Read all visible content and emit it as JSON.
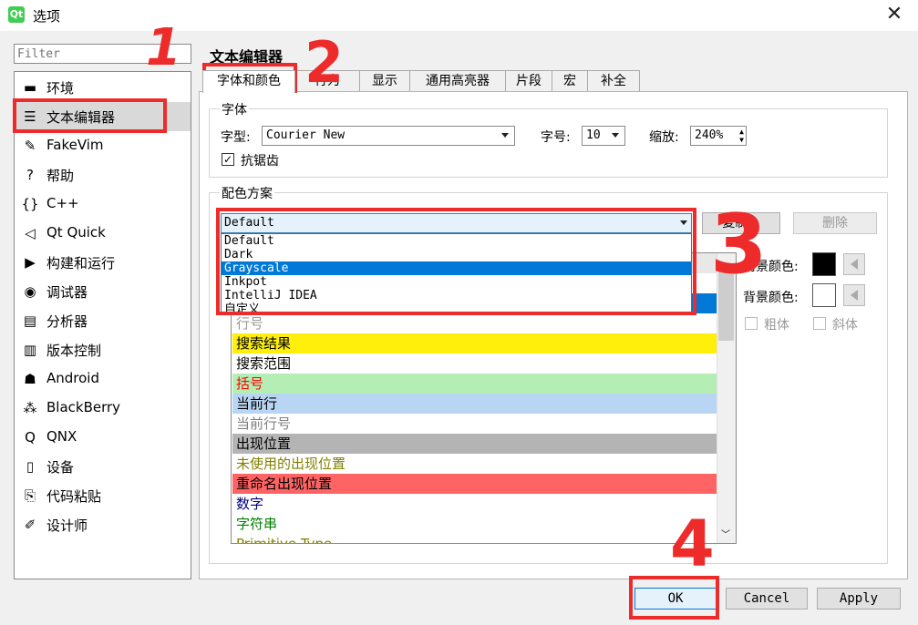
{
  "window": {
    "title": "选项",
    "app_icon": "qt-logo-icon"
  },
  "filter": {
    "placeholder": "Filter"
  },
  "nav": {
    "items": [
      {
        "label": "环境",
        "icon": "monitor-icon"
      },
      {
        "label": "文本编辑器",
        "icon": "text-editor-icon",
        "selected": true
      },
      {
        "label": "FakeVim",
        "icon": "fakevim-icon"
      },
      {
        "label": "帮助",
        "icon": "help-icon"
      },
      {
        "label": "C++",
        "icon": "braces-icon"
      },
      {
        "label": "Qt Quick",
        "icon": "qt-quick-icon"
      },
      {
        "label": "构建和运行",
        "icon": "build-run-icon"
      },
      {
        "label": "调试器",
        "icon": "debugger-icon"
      },
      {
        "label": "分析器",
        "icon": "analyzer-icon"
      },
      {
        "label": "版本控制",
        "icon": "version-control-icon"
      },
      {
        "label": "Android",
        "icon": "android-icon"
      },
      {
        "label": "BlackBerry",
        "icon": "blackberry-icon"
      },
      {
        "label": "QNX",
        "icon": "qnx-icon"
      },
      {
        "label": "设备",
        "icon": "device-icon"
      },
      {
        "label": "代码粘贴",
        "icon": "code-paste-icon"
      },
      {
        "label": "设计师",
        "icon": "designer-icon"
      }
    ]
  },
  "page": {
    "heading": "文本编辑器"
  },
  "tabs": [
    "字体和颜色",
    "行为",
    "显示",
    "通用高亮器",
    "片段",
    "宏",
    "补全"
  ],
  "font_group": {
    "title": "字体",
    "family_label": "字型:",
    "family_value": "Courier New",
    "size_label": "字号:",
    "size_value": "10",
    "zoom_label": "缩放:",
    "zoom_value": "240%",
    "antialias_label": "抗锯齿",
    "antialias_checked": true
  },
  "scheme_group": {
    "title": "配色方案",
    "selected": "Default",
    "options": [
      "Default",
      "Dark",
      "Grayscale",
      "Inkpot",
      "IntelliJ IDEA",
      "自定义"
    ],
    "highlighted_option": "Grayscale",
    "copy_button": "复制...",
    "delete_button": "删除"
  },
  "color_list": [
    {
      "label": "行号",
      "fg": "#999999",
      "bg": "#ffffff"
    },
    {
      "label": "搜索结果",
      "fg": "#000000",
      "bg": "#ffef0b"
    },
    {
      "label": "搜索范围",
      "fg": "#000000",
      "bg": "#ffffff"
    },
    {
      "label": "括号",
      "fg": "#ff0000",
      "bg": "#b4eeb4"
    },
    {
      "label": "当前行",
      "fg": "#000000",
      "bg": "#b8d6f4"
    },
    {
      "label": "当前行号",
      "fg": "#808080",
      "bg": "#ffffff"
    },
    {
      "label": "出现位置",
      "fg": "#000000",
      "bg": "#b4b4b4"
    },
    {
      "label": "未使用的出现位置",
      "fg": "#808000",
      "bg": "#ffffff"
    },
    {
      "label": "重命名出现位置",
      "fg": "#000000",
      "bg": "#ff6464"
    },
    {
      "label": "数字",
      "fg": "#000080",
      "bg": "#ffffff"
    },
    {
      "label": "字符串",
      "fg": "#008000",
      "bg": "#ffffff"
    },
    {
      "label": "Primitive Type",
      "fg": "#808000",
      "bg": "#ffffff"
    }
  ],
  "format": {
    "fg_label": "前景颜色:",
    "bg_label": "背景颜色:",
    "fg_color": "#000000",
    "bg_color": "#ffffff",
    "bold_label": "粗体",
    "italic_label": "斜体"
  },
  "buttons": {
    "ok": "OK",
    "cancel": "Cancel",
    "apply": "Apply"
  },
  "annotations": [
    "1",
    "2",
    "3",
    "4"
  ],
  "colors": {
    "selection": "#0078d7",
    "annotation": "#ee2b2b"
  }
}
